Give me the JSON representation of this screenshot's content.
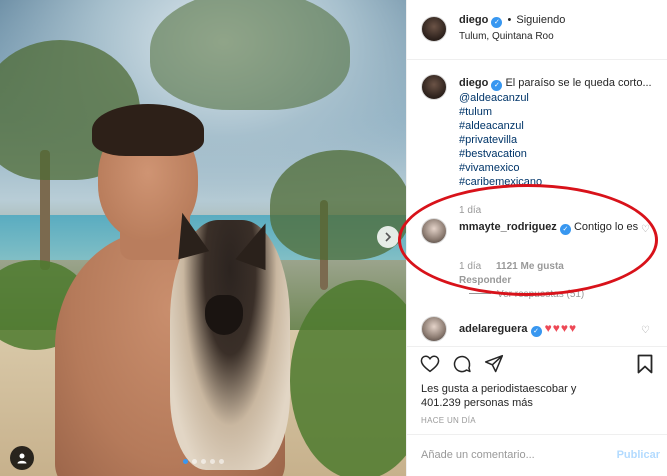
{
  "post": {
    "image_alt": "",
    "carousel_dots": 5,
    "active_dot": 0
  },
  "header": {
    "username": "diego",
    "separator": "•",
    "follow_status": "Siguiendo",
    "location": "Tulum, Quintana Roo",
    "more": "•••"
  },
  "caption": {
    "username": "diego",
    "text": "El paraíso se le queda corto...",
    "mention": "@aldeacanzul",
    "hashtags": [
      "#tulum",
      "#aldeacanzul",
      "#privatevilla",
      "#bestvacation",
      "#vivamexico",
      "#caribemexicano"
    ],
    "time": "1 día"
  },
  "comments": [
    {
      "username": "mmayte_rodriguez",
      "text": "Contigo lo es",
      "time": "1 día",
      "likes": "1121 Me gusta",
      "reply_label": "Responder",
      "view_replies": "Ver respuestas (51)"
    },
    {
      "username": "adelareguera",
      "text": "♥♥♥♥"
    }
  ],
  "likes": {
    "prefix": "Les gusta a",
    "first_user": "periodistaescobar",
    "conjunction": "y",
    "count": "401.239 personas más"
  },
  "timestamp": "HACE UN DÍA",
  "comment_box": {
    "placeholder": "Añade un comentario...",
    "publish_label": "Publicar"
  },
  "colors": {
    "accent": "#3897f0",
    "annotation": "#d8121a",
    "heart": "#ed4956"
  }
}
